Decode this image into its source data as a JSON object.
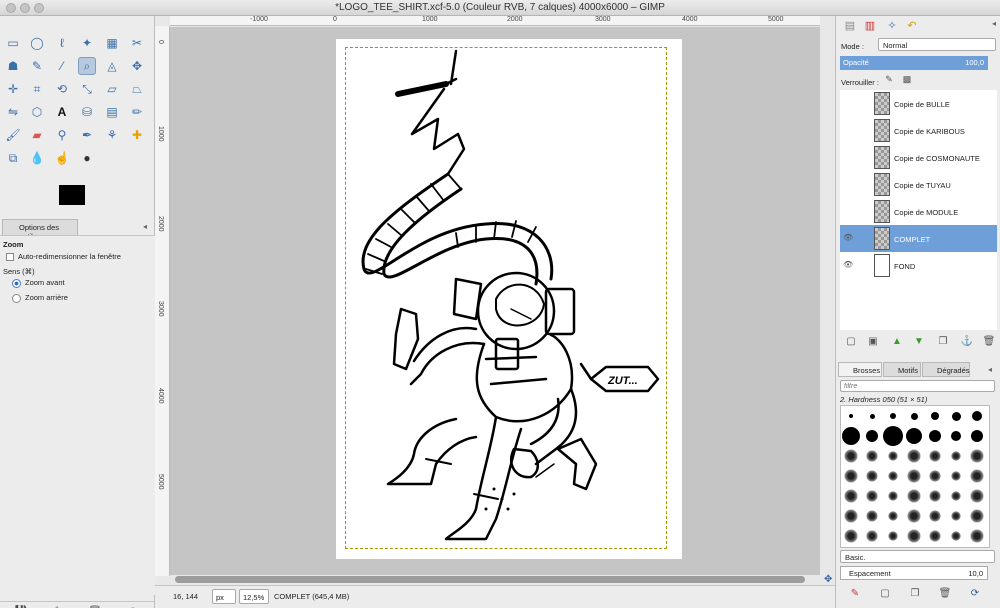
{
  "window": {
    "title": "*LOGO_TEE_SHIRT.xcf-5.0 (Couleur RVB, 7 calques) 4000x6000 – GIMP"
  },
  "tool_options": {
    "tab_label": "Options des outils",
    "tool_name": "Zoom",
    "auto_resize_label": "Auto-redimensionner la fenêtre",
    "direction_label": "Sens (⌘)",
    "zoom_in_label": "Zoom avant",
    "zoom_out_label": "Zoom arrière"
  },
  "rulers": {
    "horizontal": [
      "-1000",
      "0",
      "1000",
      "2000",
      "3000",
      "4000",
      "5000"
    ],
    "vertical": [
      "0",
      "1000",
      "2000",
      "3000",
      "4000",
      "5000"
    ]
  },
  "status": {
    "coords": "16, 144",
    "unit": "px",
    "zoom": "12,5%",
    "layer_info": "COMPLET (645,4 MB)"
  },
  "layers_panel": {
    "mode_label": "Mode :",
    "mode_value": "Normal",
    "opacity_label": "Opacité",
    "opacity_value": "100,0",
    "lock_label": "Verrouiller :",
    "layers": [
      {
        "name": "Copie de BULLE",
        "visible": false,
        "selected": false
      },
      {
        "name": "Copie de KARIBOUS",
        "visible": false,
        "selected": false
      },
      {
        "name": "Copie de COSMONAUTE",
        "visible": false,
        "selected": false
      },
      {
        "name": "Copie de TUYAU",
        "visible": false,
        "selected": false
      },
      {
        "name": "Copie de MODULE",
        "visible": false,
        "selected": false
      },
      {
        "name": "COMPLET",
        "visible": true,
        "selected": true
      },
      {
        "name": "FOND",
        "visible": true,
        "selected": false
      }
    ]
  },
  "brushes_panel": {
    "tabs": [
      "Brosses",
      "Motifs",
      "Dégradés"
    ],
    "filter_placeholder": "filtre",
    "brush_name": "2. Hardness 050 (51 × 51)",
    "preset": "Basic.",
    "spacing_label": "Espacement",
    "spacing_value": "10,0"
  },
  "artwork": {
    "speech_bubble": "ZUT..."
  },
  "colors": {
    "selection": "#6f9fd9",
    "canvas_bg": "#c5c5c5"
  }
}
